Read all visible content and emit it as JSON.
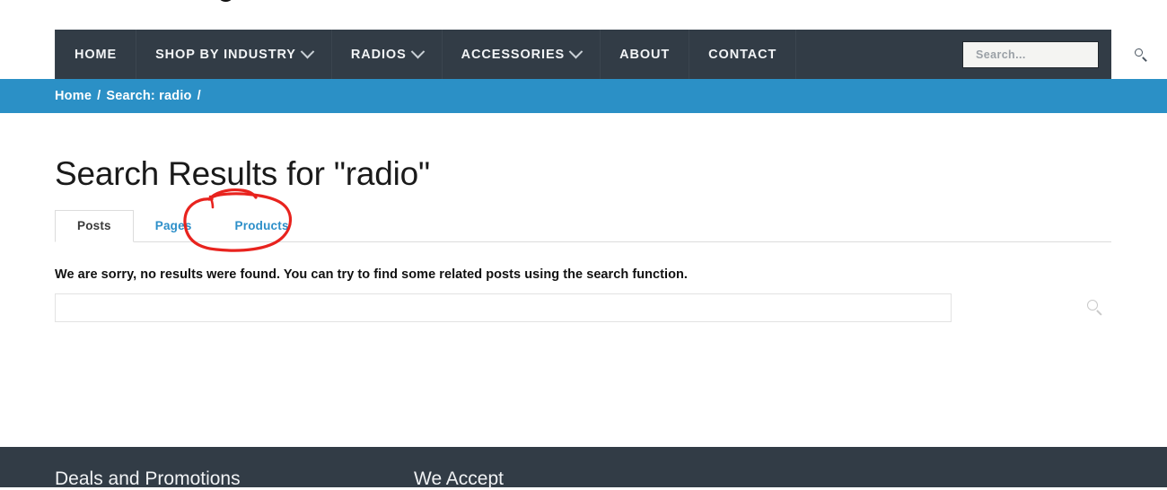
{
  "nav": {
    "items": [
      {
        "label": "HOME",
        "has_dropdown": false
      },
      {
        "label": "SHOP BY INDUSTRY",
        "has_dropdown": true
      },
      {
        "label": "RADIOS",
        "has_dropdown": true
      },
      {
        "label": "ACCESSORIES",
        "has_dropdown": true
      },
      {
        "label": "ABOUT",
        "has_dropdown": false
      },
      {
        "label": "CONTACT",
        "has_dropdown": false
      }
    ],
    "search": {
      "placeholder": "Search...",
      "value": "",
      "icon": "search-icon"
    },
    "background_color": "#323c46"
  },
  "breadcrumb": {
    "home": "Home",
    "separator_1": "/",
    "current": "Search: radio",
    "separator_2": "/",
    "background_color": "#2b90c6"
  },
  "main": {
    "title": "Search Results for \"radio\"",
    "tabs": [
      {
        "label": "Posts",
        "active": true
      },
      {
        "label": "Pages",
        "active": false
      },
      {
        "label": "Products",
        "active": false
      }
    ],
    "message": "We are sorry, no results were found. You can try to find some related posts using the search function.",
    "search": {
      "value": "",
      "placeholder": ""
    },
    "side_icon": "search-icon",
    "link_color": "#2d8fc9"
  },
  "annotation": {
    "shape": "hand-drawn-ellipse",
    "target": "Products",
    "color": "#e8231e"
  },
  "footer": {
    "columns": [
      {
        "heading": "Deals and Promotions"
      },
      {
        "heading": "We Accept"
      }
    ],
    "background_color": "#323c46"
  }
}
